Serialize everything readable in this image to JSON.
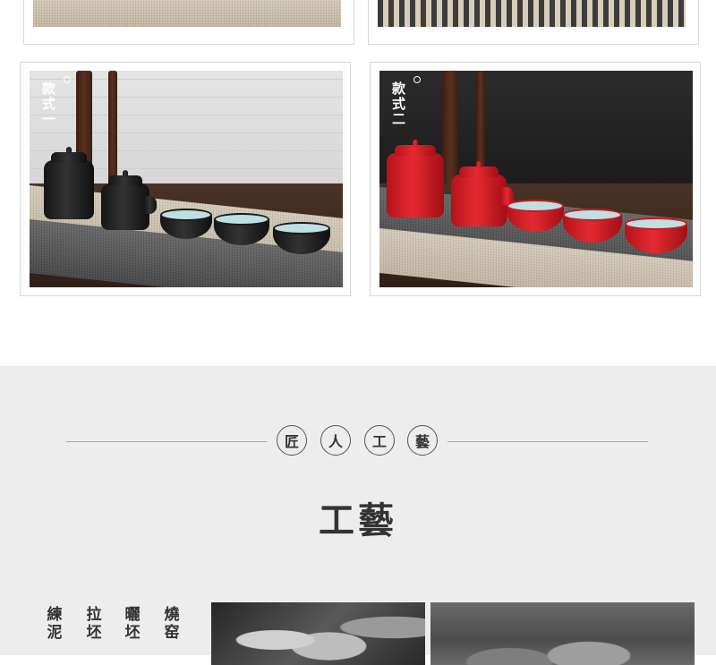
{
  "product_styles": [
    {
      "tag_chars": [
        "款",
        "式",
        "一"
      ],
      "theme": "black",
      "glaze_color": "#1a1a1a",
      "inner_color": "#bfe0e3"
    },
    {
      "tag_chars": [
        "款",
        "式",
        "二"
      ],
      "theme": "red",
      "glaze_color": "#d9232b",
      "inner_color": "#bfe0e3"
    }
  ],
  "craft": {
    "circles": [
      "匠",
      "人",
      "工",
      "藝"
    ],
    "title": "工藝",
    "steps": [
      {
        "line1": "練",
        "line2": "泥"
      },
      {
        "line1": "拉",
        "line2": "坯"
      },
      {
        "line1": "曬",
        "line2": "坯"
      },
      {
        "line1": "燒",
        "line2": "窑"
      }
    ],
    "background": "#ededed"
  }
}
